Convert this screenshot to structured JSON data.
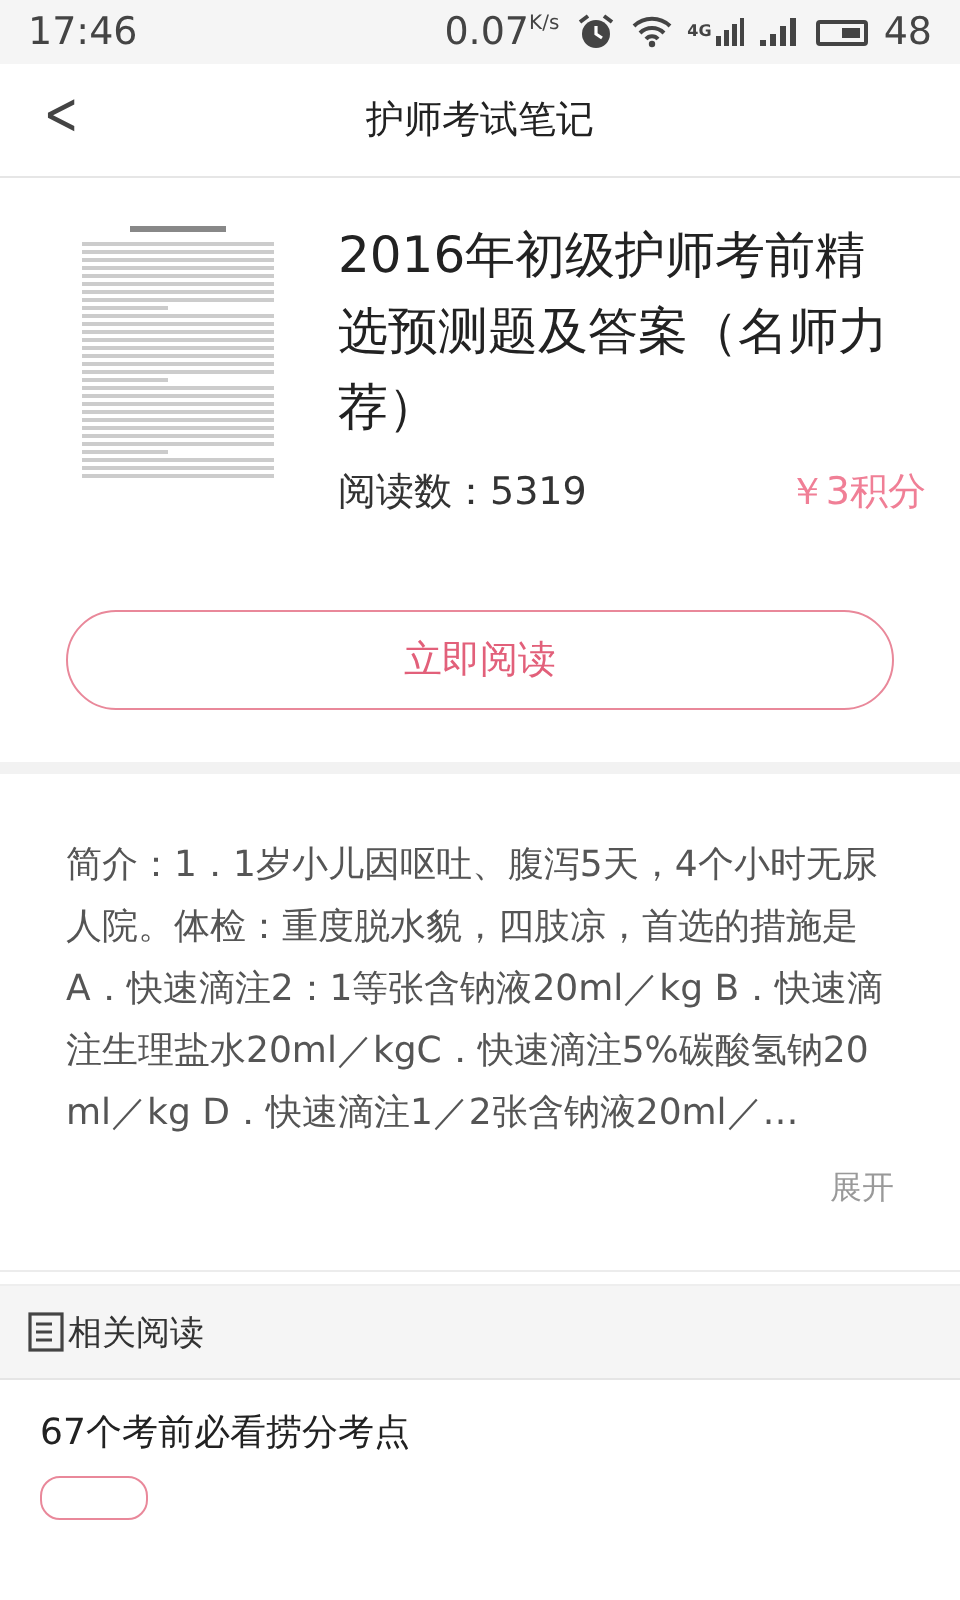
{
  "status_bar": {
    "time": "17:46",
    "net_speed": "0.07",
    "net_unit": "K/s",
    "network_type": "4G",
    "battery_text": "48"
  },
  "header": {
    "back": "<",
    "title": "护师考试笔记"
  },
  "article": {
    "title": "2016年初级护师考前精选预测题及答案（名师力荐）",
    "reads": "阅读数：5319",
    "price": "￥3积分",
    "read_button": "立即阅读"
  },
  "intro": {
    "text": "简介：1．1岁小儿因呕吐、腹泻5天，4个小时无尿人院。体检：重度脱水貌，四肢凉，首选的措施是A．快速滴注2：1等张含钠液20ml／kg B．快速滴注生理盐水20ml／kgC．快速滴注5%碳酸氢钠20ml／kg D．快速滴注1／2张含钠液20ml／…",
    "expand": "展开"
  },
  "related": {
    "heading": "相关阅读",
    "items": [
      {
        "title": "67个考前必看捞分考点"
      }
    ]
  }
}
